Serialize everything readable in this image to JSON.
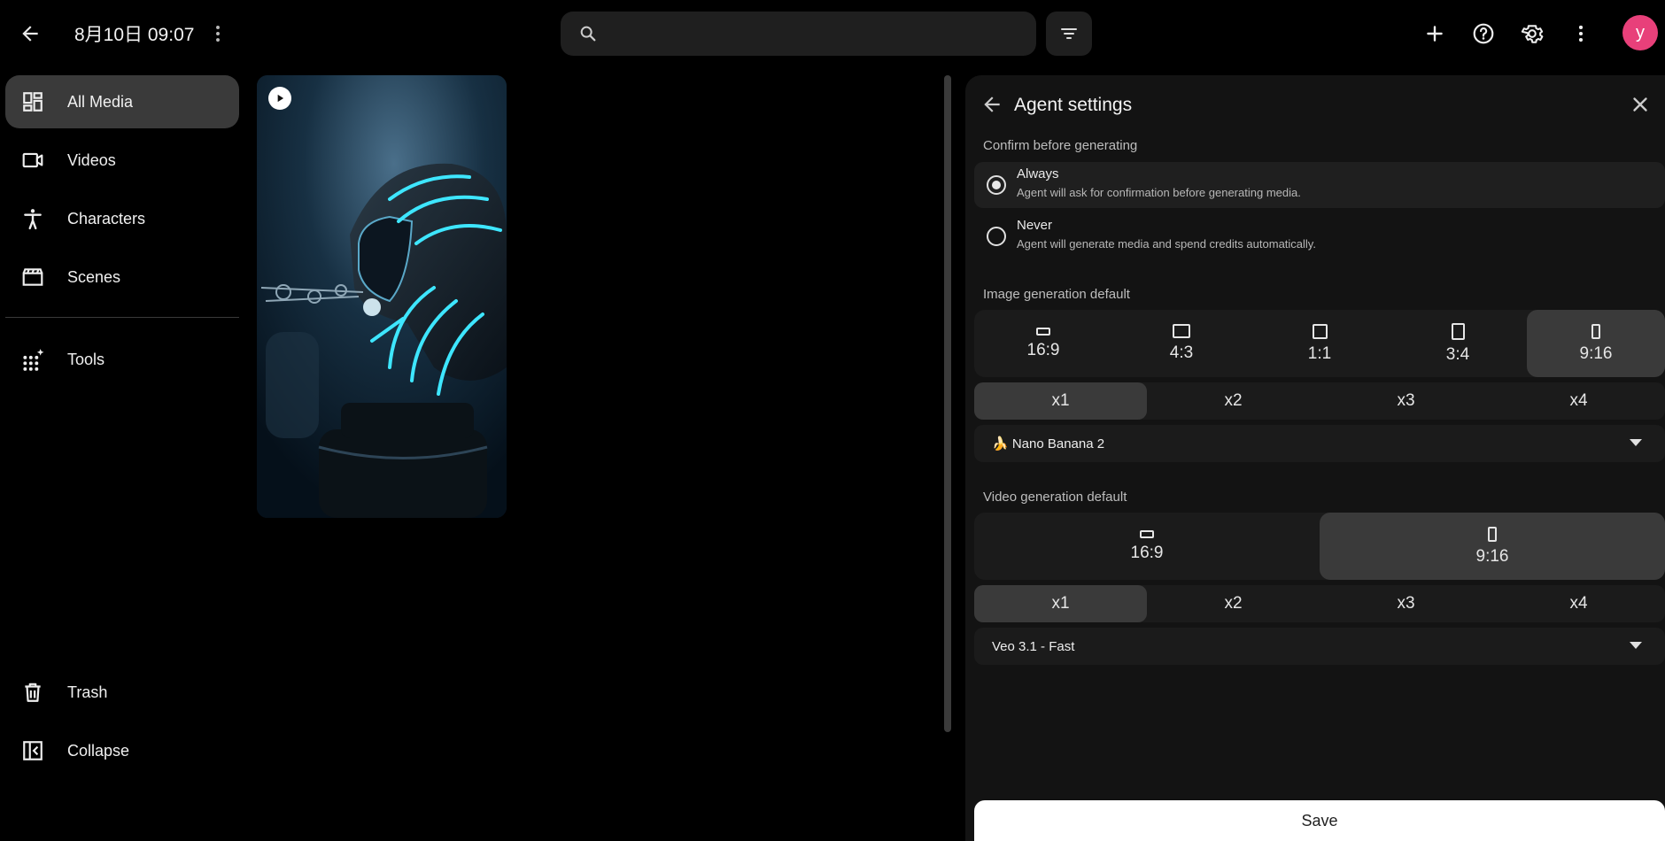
{
  "header": {
    "title": "8月10日 09:07",
    "search_placeholder": "",
    "avatar_letter": "y",
    "avatar_color": "#e8407a"
  },
  "sidebar": {
    "items": [
      {
        "label": "All Media",
        "icon": "grid-icon",
        "active": true
      },
      {
        "label": "Videos",
        "icon": "video-camera-icon"
      },
      {
        "label": "Characters",
        "icon": "person-icon"
      },
      {
        "label": "Scenes",
        "icon": "clapperboard-icon"
      },
      {
        "label": "Tools",
        "icon": "tools-sparkle-icon"
      }
    ],
    "bottom_items": [
      {
        "label": "Trash",
        "icon": "trash-icon"
      },
      {
        "label": "Collapse",
        "icon": "collapse-sidebar-icon"
      }
    ]
  },
  "media": {
    "items": [
      {
        "type": "video",
        "description_icon": "play-icon"
      }
    ]
  },
  "panel": {
    "title": "Agent settings",
    "confirm": {
      "label": "Confirm before generating",
      "options": [
        {
          "title": "Always",
          "desc": "Agent will ask for confirmation before generating media.",
          "selected": true
        },
        {
          "title": "Never",
          "desc": "Agent will generate media and spend credits automatically.",
          "selected": false
        }
      ]
    },
    "image": {
      "label": "Image generation default",
      "ratios": [
        "16:9",
        "4:3",
        "1:1",
        "3:4",
        "9:16"
      ],
      "selected_ratio": "9:16",
      "multipliers": [
        "x1",
        "x2",
        "x3",
        "x4"
      ],
      "selected_multiplier": "x1",
      "model": "🍌 Nano Banana 2"
    },
    "video": {
      "label": "Video generation default",
      "ratios": [
        "16:9",
        "9:16"
      ],
      "selected_ratio": "9:16",
      "multipliers": [
        "x1",
        "x2",
        "x3",
        "x4"
      ],
      "selected_multiplier": "x1",
      "model": "Veo 3.1 - Fast"
    },
    "save_label": "Save"
  }
}
